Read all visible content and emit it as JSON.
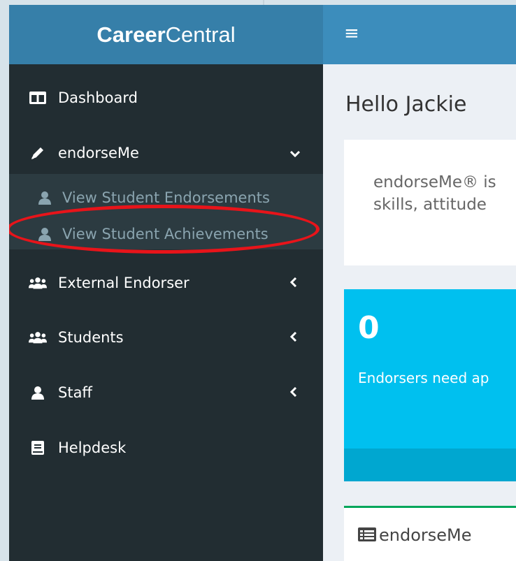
{
  "brand": {
    "bold": "Career",
    "light": "Central"
  },
  "topbar": {
    "menu_icon": "hamburger-icon"
  },
  "sidebar": {
    "items": [
      {
        "label": "Dashboard",
        "icon": "columns-icon"
      },
      {
        "label": "endorseMe",
        "icon": "pencil-icon",
        "expanded": true
      },
      {
        "label": "External Endorser",
        "icon": "users-icon"
      },
      {
        "label": "Students",
        "icon": "users-icon"
      },
      {
        "label": "Staff",
        "icon": "user-icon"
      },
      {
        "label": "Helpdesk",
        "icon": "book-icon"
      }
    ],
    "submenu": [
      {
        "label": "View Student Endorsements",
        "icon": "user-icon"
      },
      {
        "label": "View Student Achievements",
        "icon": "user-icon",
        "highlighted": true
      }
    ]
  },
  "main": {
    "greeting": "Hello Jackie",
    "intro_line1": "endorseMe® is",
    "intro_line2": "skills, attitude",
    "stat": {
      "value": "0",
      "label": "Endorsers need ap"
    },
    "panel_title": "endorseMe"
  },
  "colors": {
    "header": "#3c8dbc",
    "logo": "#367fa9",
    "sidebar": "#222d32",
    "stat": "#00c0ef",
    "highlight": "#e8141a"
  }
}
